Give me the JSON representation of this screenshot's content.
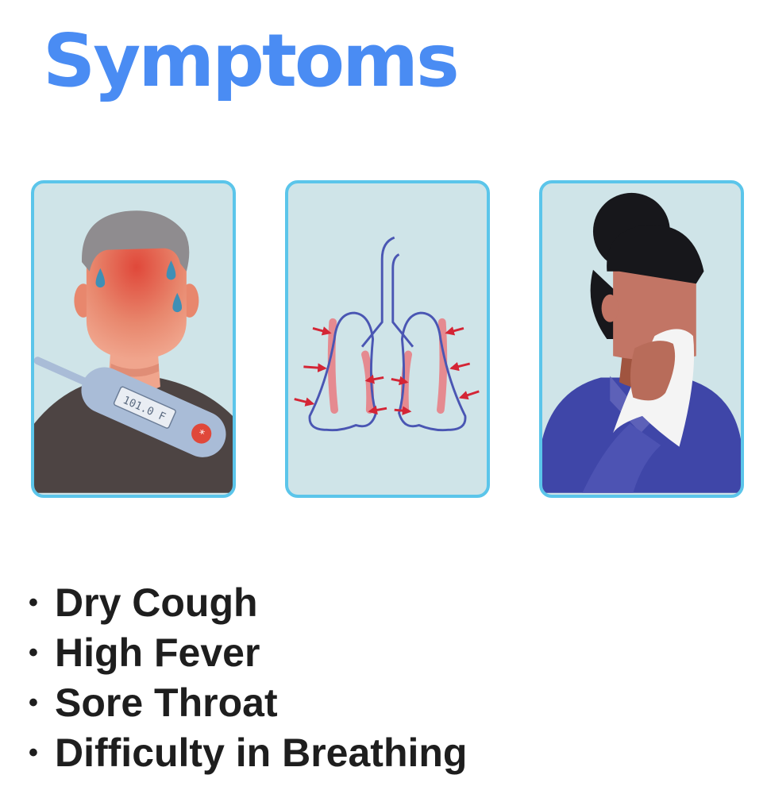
{
  "title": "Symptoms",
  "thermometer_reading": "101.0 F",
  "colors": {
    "title": "#4a8cf3",
    "card_border": "#5bc5ea",
    "card_bg": "#cfe4e8",
    "bullet_text": "#1e1e1e"
  },
  "symptoms": [
    {
      "bullet": "•",
      "label": "Dry Cough"
    },
    {
      "bullet": "•",
      "label": "High Fever"
    },
    {
      "bullet": "•",
      "label": "Sore Throat"
    },
    {
      "bullet": "•",
      "label": "Difficulty in Breathing"
    }
  ]
}
